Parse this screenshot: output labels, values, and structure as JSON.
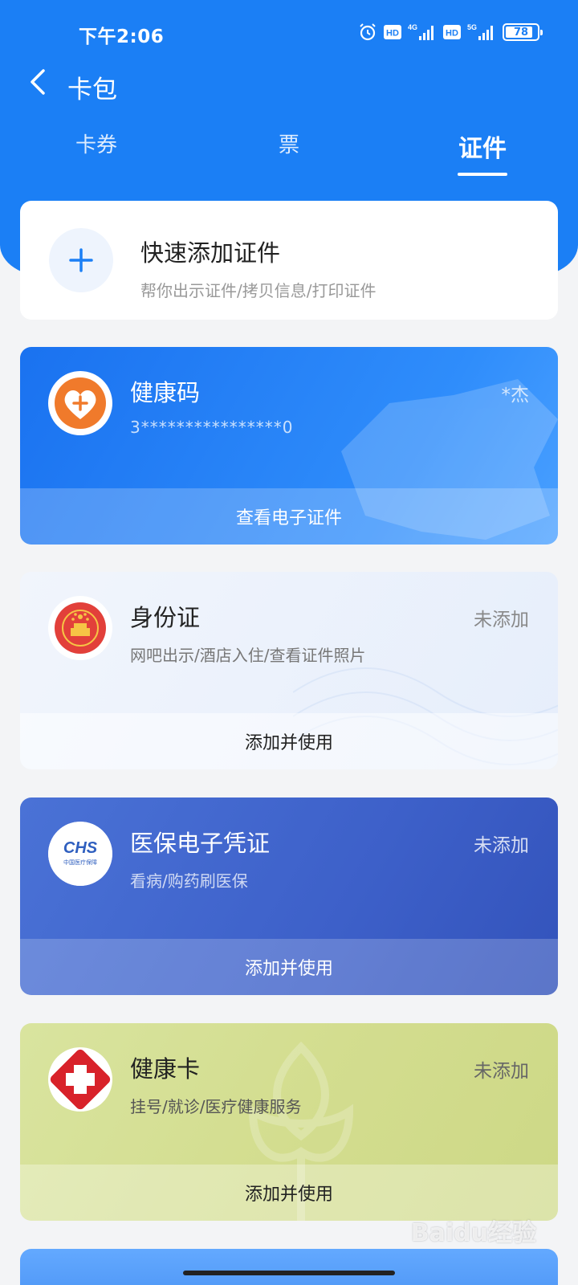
{
  "status_bar": {
    "time": "下午2:06",
    "signal_4g": "4G",
    "signal_5g": "5G",
    "hd_label": "HD",
    "battery": "78"
  },
  "nav": {
    "title": "卡包"
  },
  "tabs": [
    {
      "label": "卡券",
      "active": false
    },
    {
      "label": "票",
      "active": false
    },
    {
      "label": "证件",
      "active": true
    }
  ],
  "quick_add": {
    "title": "快速添加证件",
    "subtitle": "帮你出示证件/拷贝信息/打印证件"
  },
  "cards": [
    {
      "title": "健康码",
      "subtitle": "3****************0",
      "status": "*杰",
      "action": "查看电子证件"
    },
    {
      "title": "身份证",
      "subtitle": "网吧出示/酒店入住/查看证件照片",
      "status": "未添加",
      "action": "添加并使用"
    },
    {
      "title": "医保电子凭证",
      "subtitle": "看病/购药刷医保",
      "status": "未添加",
      "action": "添加并使用",
      "logo_text": "CHS",
      "logo_subtext": "中国医疗保障"
    },
    {
      "title": "健康卡",
      "subtitle": "挂号/就诊/医疗健康服务",
      "status": "未添加",
      "action": "添加并使用"
    }
  ],
  "watermark": "Baidu经验",
  "colors": {
    "header_blue": "#1b7ff5",
    "health_code_blue": "#2f8dfb",
    "insurance_blue": "#3d60c9",
    "healthcard_green": "#d3dd8f",
    "accent_plus": "#1b7ff5"
  }
}
